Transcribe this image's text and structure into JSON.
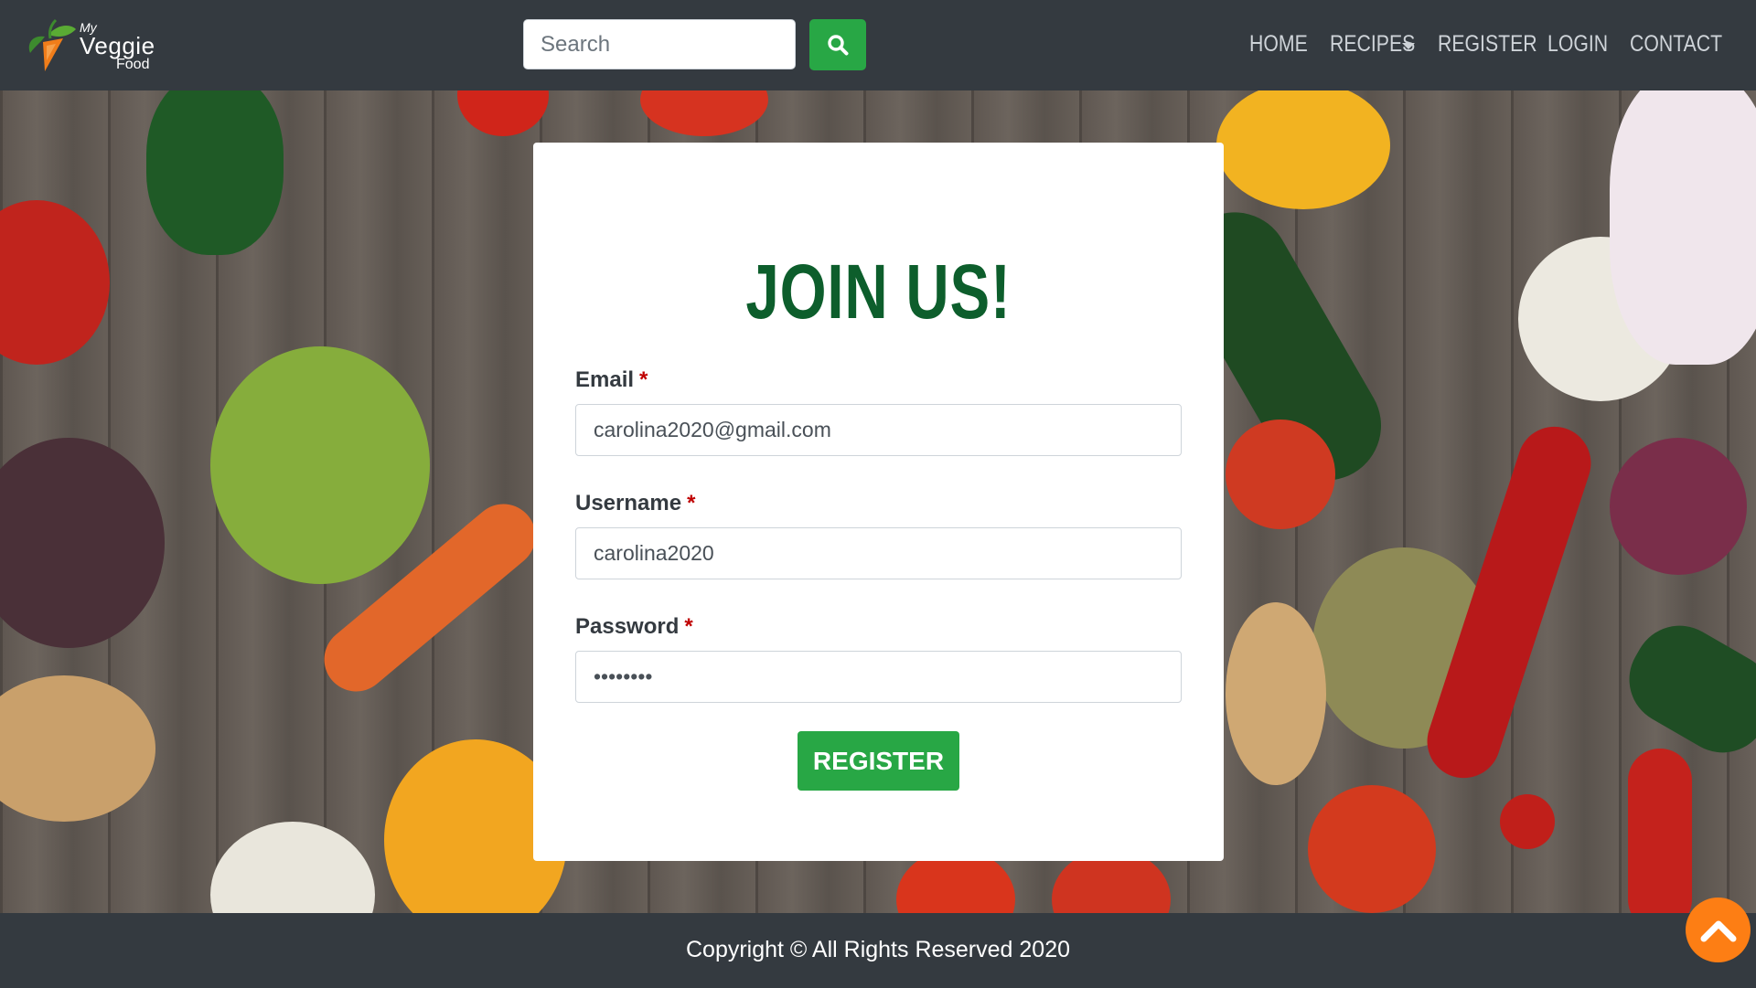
{
  "brand": {
    "my": "My",
    "veggie": "Veggie",
    "food": "Food"
  },
  "search": {
    "placeholder": "Search",
    "value": ""
  },
  "nav": {
    "home": "HOME",
    "recipes": "RECIPES",
    "register": "REGISTER",
    "login": "LOGIN",
    "contact": "CONTACT"
  },
  "form": {
    "title": "JOIN US!",
    "required_mark": "*",
    "email_label": "Email",
    "email_value": "carolina2020@gmail.com",
    "username_label": "Username",
    "username_value": "carolina2020",
    "password_label": "Password",
    "password_value": "carolina",
    "submit_label": "REGISTER"
  },
  "footer": {
    "copyright": "Copyright © All Rights Reserved 2020"
  },
  "colors": {
    "nav_bg": "#343a40",
    "accent_green": "#28a745",
    "title_green": "#0d5e2c",
    "scroll_orange": "#fd7e14"
  },
  "icons": {
    "search": "search-icon",
    "scroll_top": "chevron-up-icon",
    "dropdown": "caret-down-icon"
  }
}
